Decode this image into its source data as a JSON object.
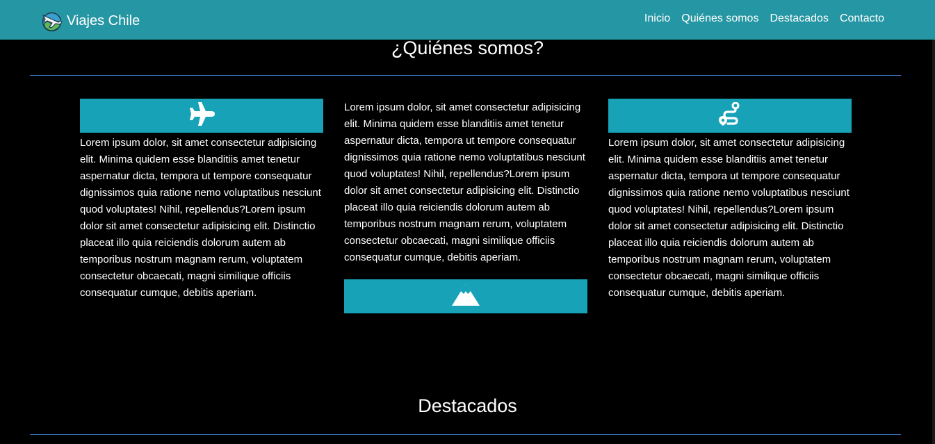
{
  "brand": {
    "name": "Viajes Chile",
    "logo_icon": "globe-plane-logo-icon"
  },
  "nav": {
    "items": [
      {
        "label": "Inicio"
      },
      {
        "label": "Quiénes somos"
      },
      {
        "label": "Destacados"
      },
      {
        "label": "Contacto"
      }
    ]
  },
  "about": {
    "title": "¿Quiénes somos?",
    "columns": [
      {
        "icon": "plane-icon",
        "text": "Lorem ipsum dolor, sit amet consectetur adipisicing elit. Minima quidem esse blanditiis amet tenetur aspernatur dicta, tempora ut tempore consequatur dignissimos quia ratione nemo voluptatibus nesciunt quod voluptates! Nihil, repellendus?Lorem ipsum dolor sit amet consectetur adipisicing elit. Distinctio placeat illo quia reiciendis dolorum autem ab temporibus nostrum magnam rerum, voluptatem consectetur obcaecati, magni similique officiis consequatur cumque, debitis aperiam."
      },
      {
        "icon": "mountain-icon",
        "text": "Lorem ipsum dolor, sit amet consectetur adipisicing elit. Minima quidem esse blanditiis amet tenetur aspernatur dicta, tempora ut tempore consequatur dignissimos quia ratione nemo voluptatibus nesciunt quod voluptates! Nihil, repellendus?Lorem ipsum dolor sit amet consectetur adipisicing elit. Distinctio placeat illo quia reiciendis dolorum autem ab temporibus nostrum magnam rerum, voluptatem consectetur obcaecati, magni similique officiis consequatur cumque, debitis aperiam."
      },
      {
        "icon": "route-icon",
        "text": "Lorem ipsum dolor, sit amet consectetur adipisicing elit. Minima quidem esse blanditiis amet tenetur aspernatur dicta, tempora ut tempore consequatur dignissimos quia ratione nemo voluptatibus nesciunt quod voluptates! Nihil, repellendus?Lorem ipsum dolor sit amet consectetur adipisicing elit. Distinctio placeat illo quia reiciendis dolorum autem ab temporibus nostrum magnam rerum, voluptatem consectetur obcaecati, magni similique officiis consequatur cumque, debitis aperiam."
      }
    ]
  },
  "featured": {
    "title": "Destacados"
  },
  "colors": {
    "navbar": "#2596a3",
    "icon_bar": "#17a2b8",
    "rule": "#3f7fcf",
    "background": "#000000"
  }
}
